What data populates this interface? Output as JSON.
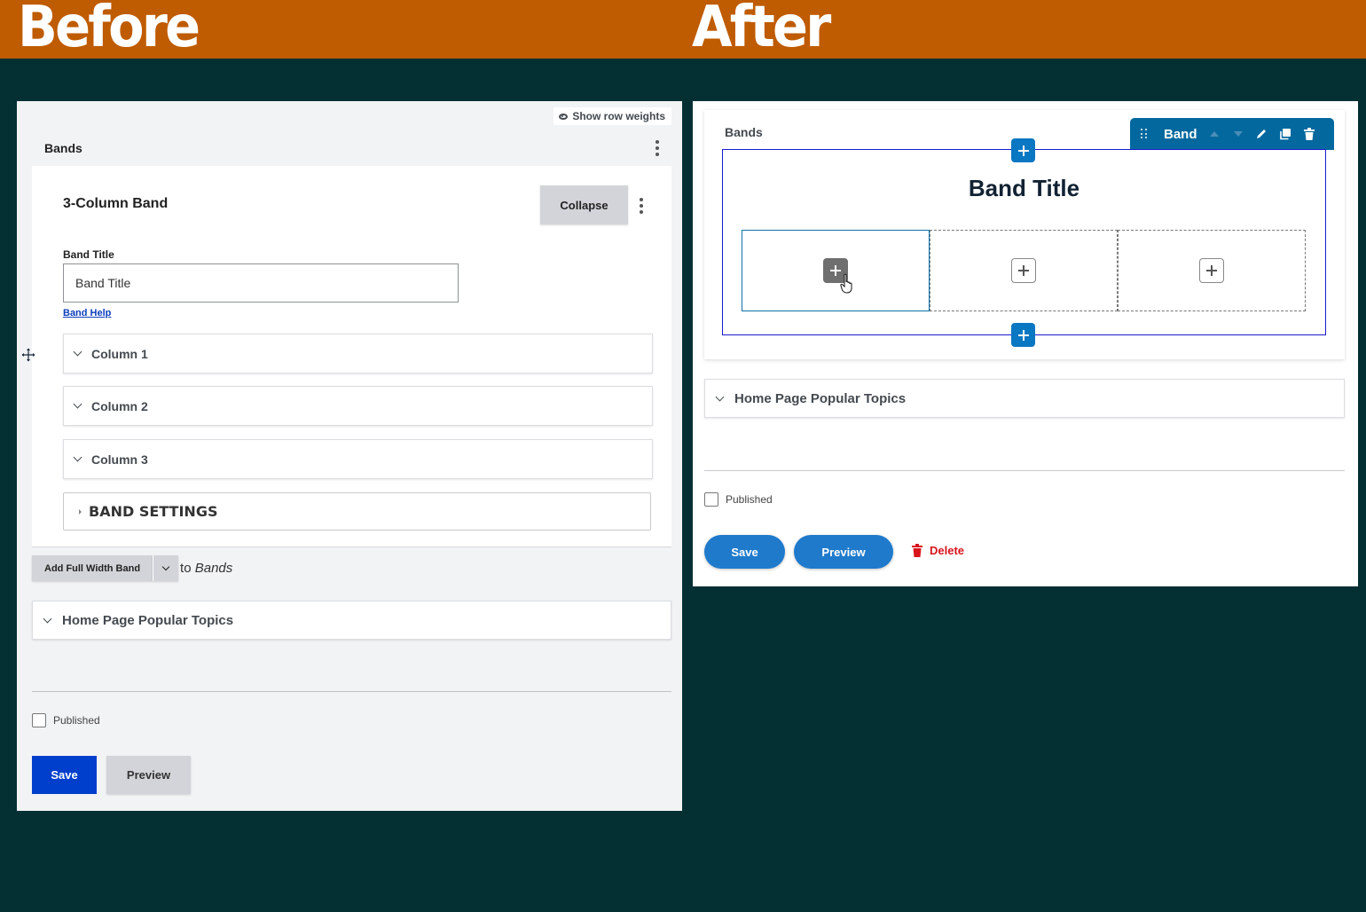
{
  "banner": {
    "before": "Before",
    "after": "After",
    "color": "#bf5b00",
    "background": "#053033"
  },
  "before": {
    "show_row_weights": "Show row weights",
    "section_title": "Bands",
    "band": {
      "title": "3-Column Band",
      "collapse_label": "Collapse",
      "field_label": "Band Title",
      "field_value": "Band Title",
      "help_link": "Band Help",
      "columns": [
        "Column 1",
        "Column 2",
        "Column 3"
      ],
      "settings_label": "BAND SETTINGS"
    },
    "add_band": {
      "button_label": "Add Full Width Band",
      "to": "to",
      "target": "Bands"
    },
    "popular_topics": "Home Page Popular Topics",
    "published_label": "Published",
    "published_checked": false,
    "save_label": "Save",
    "preview_label": "Preview",
    "save_color": "#003ecc"
  },
  "after": {
    "section_title": "Bands",
    "toolbar": {
      "label": "Band",
      "icons": [
        "drag-handle-icon",
        "move-up-icon",
        "move-down-icon",
        "edit-icon",
        "duplicate-icon",
        "delete-icon"
      ],
      "color": "#03689e"
    },
    "band_title": "Band Title",
    "column_slots": 3,
    "popular_topics": "Home Page Popular Topics",
    "published_label": "Published",
    "published_checked": false,
    "save_label": "Save",
    "preview_label": "Preview",
    "delete_label": "Delete",
    "button_color": "#1f7acc",
    "delete_color": "#d8141c"
  }
}
